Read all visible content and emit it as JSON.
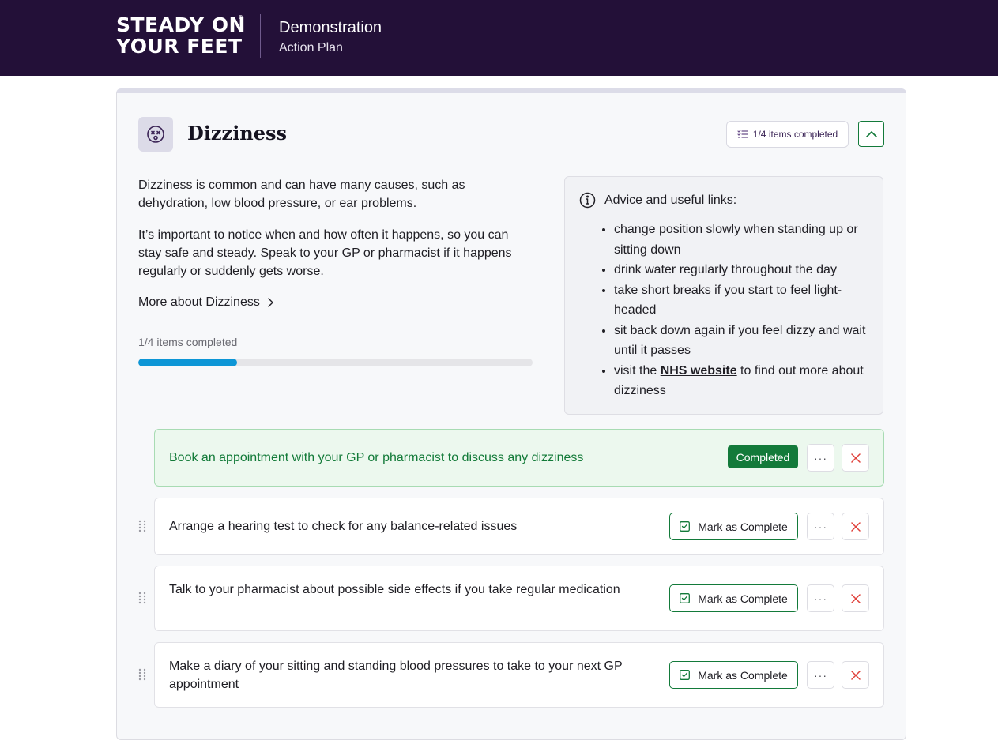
{
  "header": {
    "logo_line1": "STEADY ON",
    "logo_line2": "YOUR FEET",
    "logo_reg": "©",
    "title": "Demonstration",
    "subtitle": "Action Plan"
  },
  "topic": {
    "icon": "dizzy-face-icon",
    "title": "Dizziness",
    "items_completed_label": "1/4 items completed",
    "description_1": "Dizziness is common and can have many causes, such as dehydration, low blood pressure, or ear problems.",
    "description_2": "It’s important to notice when and how often it happens, so you can stay safe and steady. Speak to your GP or pharmacist if it happens regularly or suddenly gets worse.",
    "more_link": "More about Dizziness",
    "progress_label": "1/4 items completed",
    "progress_fraction": 0.25
  },
  "advice": {
    "heading": "Advice and useful links:",
    "items": [
      "change position slowly when standing up or sitting down",
      "drink water regularly throughout the day",
      "take short breaks if you start to feel light-headed",
      "sit back down again if you feel dizzy and wait until it passes"
    ],
    "last_item_prefix": "visit the ",
    "last_item_link": "NHS website",
    "last_item_suffix": " to find out more about dizziness"
  },
  "tasks": [
    {
      "text": "Book an appointment with your GP or pharmacist to discuss any dizziness",
      "status": "Completed"
    },
    {
      "text": "Arrange a hearing test to check for any balance-related issues",
      "action": "Mark as Complete"
    },
    {
      "text": "Talk to your pharmacist about possible side effects if you take regular medication",
      "action": "Mark as Complete"
    },
    {
      "text": "Make a diary of your sitting and standing blood pressures to take to your next GP appointment",
      "action": "Mark as Complete"
    }
  ],
  "buttons": {
    "more": "···"
  },
  "colors": {
    "header_bg": "#231038",
    "accent_green": "#137a3a",
    "progress_blue": "#0d96d6",
    "delete_red": "#e0413b"
  }
}
